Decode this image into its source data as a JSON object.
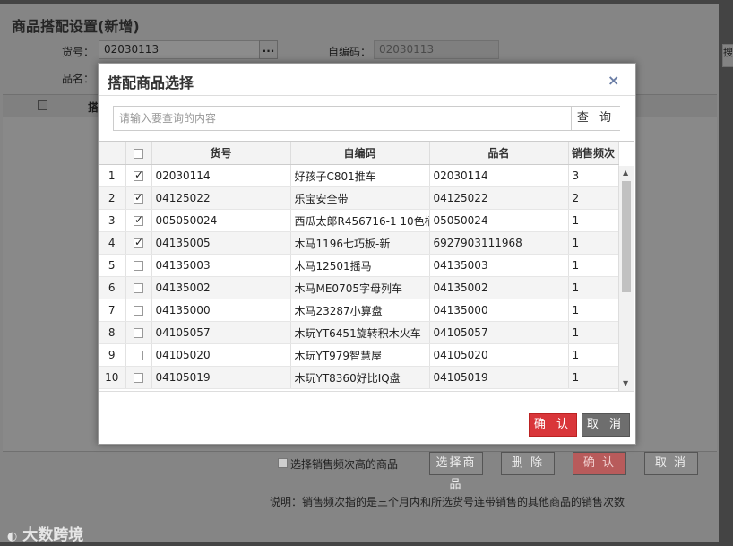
{
  "window": {
    "title": "商品搭配设置(新增)",
    "huohao_label": "货号：",
    "huohao_value": "02030113",
    "dots": "...",
    "zibianma_label": "自编码：",
    "zibianma_value": "02030113",
    "pinming_label": "品名：",
    "grid_header_fragment": "搭",
    "side_fragment": "搜"
  },
  "modal": {
    "title": "搭配商品选择",
    "close": "×",
    "search_placeholder": "请输入要查询的内容",
    "search_button": "查 询",
    "columns": [
      "货号",
      "自编码",
      "品名",
      "销售频次"
    ],
    "rows": [
      {
        "n": "1",
        "checked": true,
        "huohao": "02030114",
        "zibianma": "好孩子C801推车",
        "pinming": "02030114",
        "freq": "3"
      },
      {
        "n": "2",
        "checked": true,
        "huohao": "04125022",
        "zibianma": "乐宝安全带",
        "pinming": "04125022",
        "freq": "2"
      },
      {
        "n": "3",
        "checked": true,
        "huohao": "005050024",
        "zibianma": "西瓜太郎R456716-1 10色桶",
        "pinming": "05050024",
        "freq": "1"
      },
      {
        "n": "4",
        "checked": true,
        "huohao": "04135005",
        "zibianma": "木马1196七巧板-新",
        "pinming": "6927903111968",
        "freq": "1"
      },
      {
        "n": "5",
        "checked": false,
        "huohao": "04135003",
        "zibianma": "木马12501摇马",
        "pinming": "04135003",
        "freq": "1"
      },
      {
        "n": "6",
        "checked": false,
        "huohao": "04135002",
        "zibianma": "木马ME0705字母列车",
        "pinming": "04135002",
        "freq": "1"
      },
      {
        "n": "7",
        "checked": false,
        "huohao": "04135000",
        "zibianma": "木马23287小算盘",
        "pinming": "04135000",
        "freq": "1"
      },
      {
        "n": "8",
        "checked": false,
        "huohao": "04105057",
        "zibianma": "木玩YT6451旋转积木火车",
        "pinming": "04105057",
        "freq": "1"
      },
      {
        "n": "9",
        "checked": false,
        "huohao": "04105020",
        "zibianma": "木玩YT979智慧屋",
        "pinming": "04105020",
        "freq": "1"
      },
      {
        "n": "10",
        "checked": false,
        "huohao": "04105019",
        "zibianma": "木玩YT8360好比IQ盘",
        "pinming": "04105019",
        "freq": "1"
      }
    ],
    "ok_button": "确 认",
    "cancel_button": "取 消"
  },
  "footer": {
    "checkbox_label": "选择销售频次高的商品",
    "select_button": "选择商品",
    "delete_button": "删 除",
    "ok_button": "确 认",
    "cancel_button": "取 消",
    "note": "说明：销售频次指的是三个月内和所选货号连带销售的其他商品的销售次数"
  },
  "watermark": "大数跨境",
  "colors": {
    "primary_red": "#d9363a",
    "gray_button": "#6e6e6e",
    "close_icon": "#6b7ea6"
  }
}
